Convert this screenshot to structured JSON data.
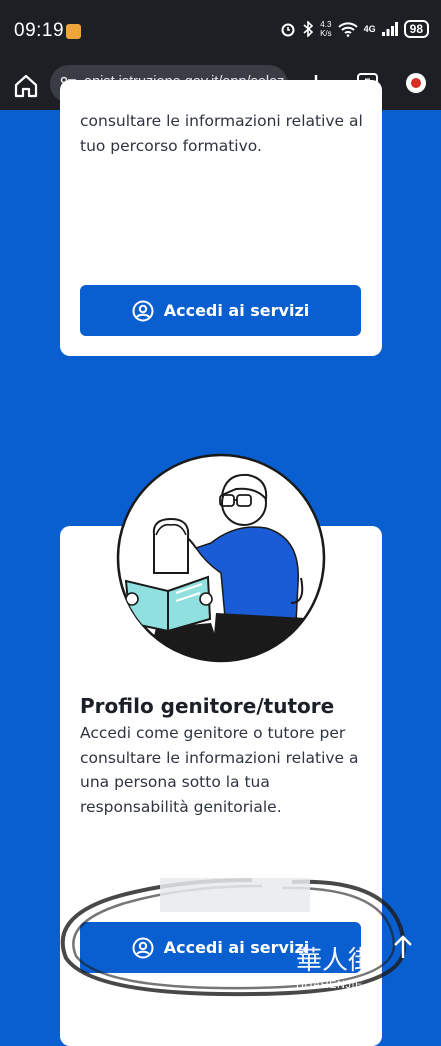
{
  "status_bar": {
    "time": "09:19",
    "speed_value": "4.3",
    "speed_unit": "K/s",
    "network": "4G",
    "battery": "98"
  },
  "browser": {
    "url": "anist.istruzione.gov.it/app/selez",
    "tabs_count": "5"
  },
  "card1": {
    "description": "consultare le informazioni relative al tuo percorso formativo.",
    "button_label": "Accedi ai servizi"
  },
  "card2": {
    "title": "Profilo genitore/tutore",
    "description": "Accedi come genitore o tutore per consultare le informazioni relative a una persona sotto la tua responsabilità genitoriale.",
    "button_label": "Accedi ai servizi"
  },
  "watermark": {
    "chinese": "華人街",
    "latin": "HUARENJIE"
  },
  "colors": {
    "brand_blue": "#0a5fd0",
    "status_bg": "#1d1f24",
    "card_bg": "#ffffff"
  },
  "icons": [
    "home-icon",
    "tune-icon",
    "plus-icon",
    "tabs-icon",
    "menu-icon",
    "user-circle-icon",
    "scroll-top-icon"
  ]
}
